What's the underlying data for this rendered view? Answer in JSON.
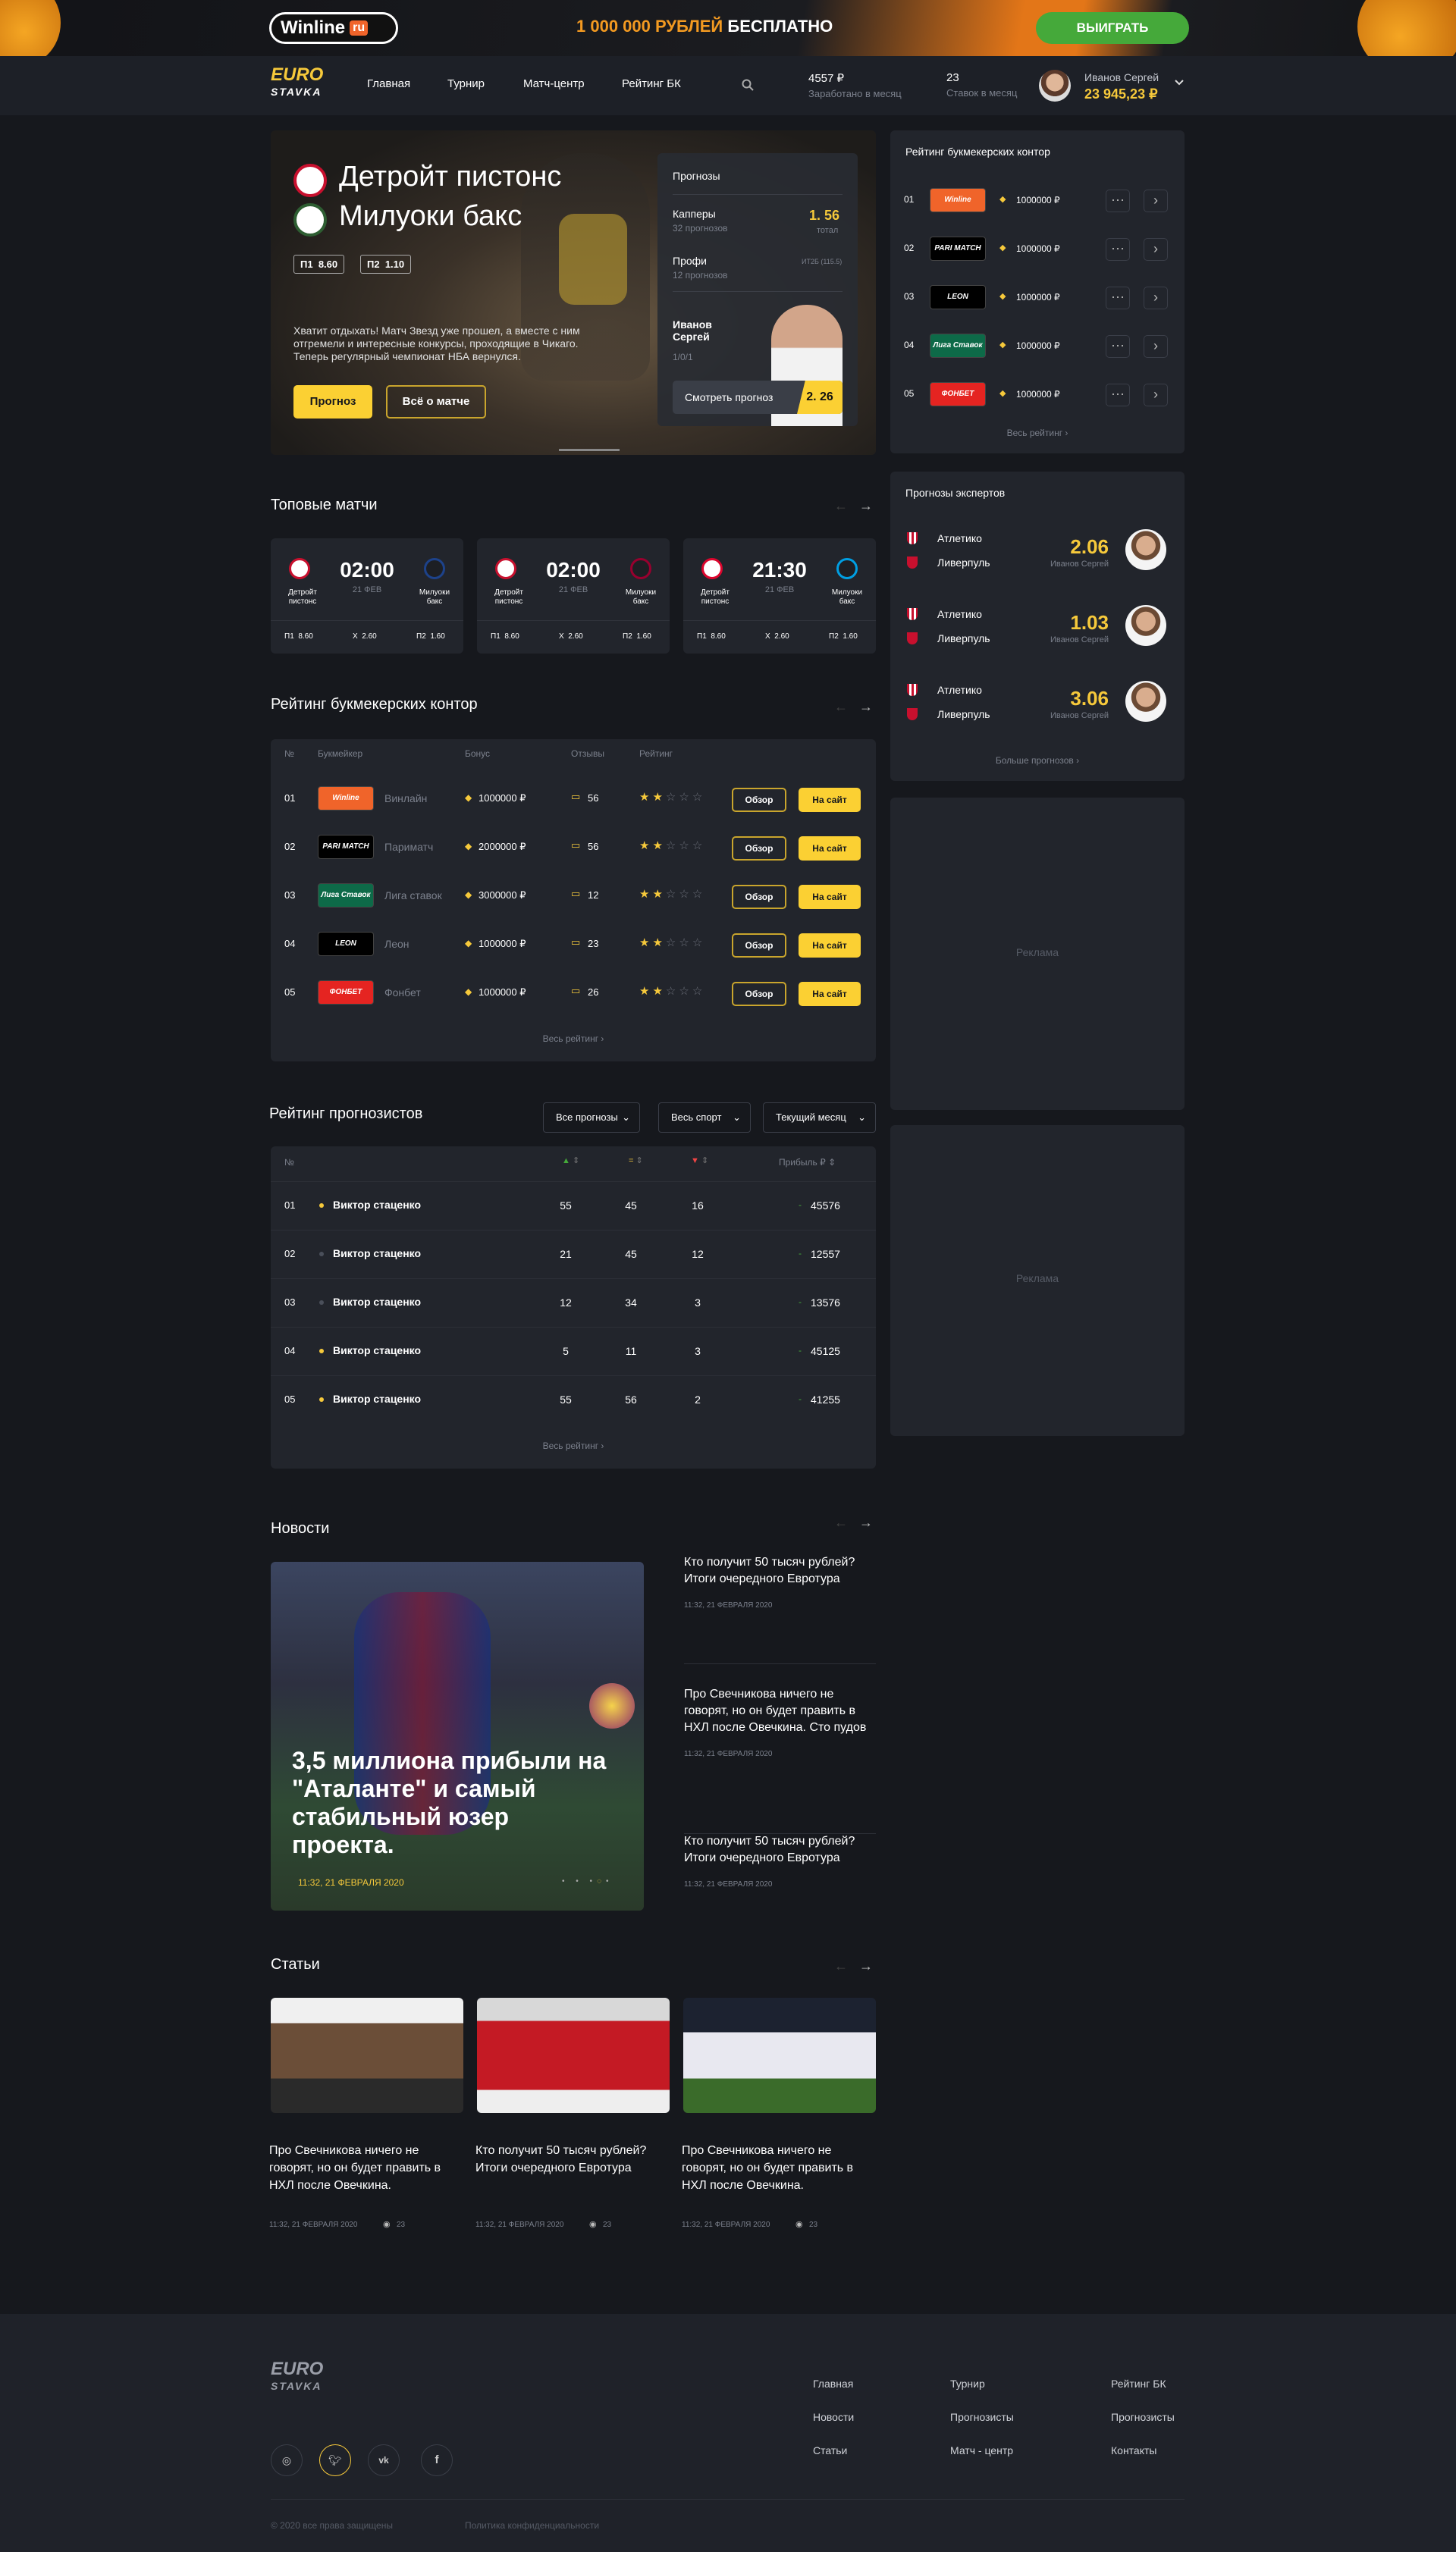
{
  "promo": {
    "logo": "Winline",
    "logo_suffix": "ru",
    "text_yellow": "1 000 000 РУБЛЕЙ",
    "text_white": "БЕСПЛАТНО",
    "button": "ВЫИГРАТЬ"
  },
  "nav": {
    "logo_top": "EURO",
    "logo_bottom": "STAVKA",
    "items": [
      "Главная",
      "Турнир",
      "Матч-центр",
      "Рейтинг БК"
    ],
    "stat1_value": "4557 ₽",
    "stat1_label": "Заработано в месяц",
    "stat2_value": "23",
    "stat2_label": "Ставок в месяц",
    "user_name": "Иванов Сергей",
    "user_balance": "23 945,23 ₽"
  },
  "hero": {
    "team1": "Детройт пистонс",
    "team2": "Милуоки бакс",
    "odd1_label": "П1",
    "odd1": "8.60",
    "odd2_label": "П2",
    "odd2": "1.10",
    "desc": "Хватит отдыхать! Матч Звезд уже прошел, а вместе с ним отгремели и интересные конкурсы, проходящие в Чикаго. Теперь регулярный чемпионат НБА вернулся.",
    "btn_forecast": "Прогноз",
    "btn_about": "Всё о матче",
    "card": {
      "title": "Прогнозы",
      "row1_title": "Капперы",
      "row1_sub": "32 прогнозов",
      "row1_val": "1. 56",
      "row1_val_sub": "тотал",
      "row2_title": "Профи",
      "row2_sub": "12 прогнозов",
      "row2_val": "ИТ2Б (115.5)",
      "expert_first": "Иванов",
      "expert_last": "Сергей",
      "expert_score": "1/0/1",
      "watch_btn": "Смотреть прогноз",
      "watch_val": "2. 26"
    }
  },
  "top_matches": {
    "title": "Топовые матчи",
    "matches": [
      {
        "time": "02:00",
        "date": "21 ФЕВ",
        "team1": "Детройт пистонс",
        "team2": "Милуоки бакс",
        "p1_label": "П1",
        "p1": "8.60",
        "x_label": "X",
        "x": "2.60",
        "p2_label": "П2",
        "p2": "1.60"
      },
      {
        "time": "02:00",
        "date": "21 ФЕВ",
        "team1": "Детройт пистонс",
        "team2": "Милуоки бакс",
        "p1_label": "П1",
        "p1": "8.60",
        "x_label": "X",
        "x": "2.60",
        "p2_label": "П2",
        "p2": "1.60"
      },
      {
        "time": "21:30",
        "date": "21 ФЕВ",
        "team1": "Детройт пистонс",
        "team2": "Милуоки бакс",
        "p1_label": "П1",
        "p1": "8.60",
        "x_label": "X",
        "x": "2.60",
        "p2_label": "П2",
        "p2": "1.60"
      }
    ]
  },
  "bk_rating": {
    "title": "Рейтинг букмекерских контор",
    "headers": [
      "№",
      "Букмейкер",
      "Бонус",
      "Отзывы",
      "Рейтинг"
    ],
    "rows": [
      {
        "num": "01",
        "logo": "Winline",
        "name": "Винлайн",
        "bonus": "1000000 ₽",
        "reviews": "56",
        "stars": 2,
        "logo_bg": "#f0642a"
      },
      {
        "num": "02",
        "logo": "PARI MATCH",
        "name": "Париматч",
        "bonus": "2000000 ₽",
        "reviews": "56",
        "stars": 2,
        "logo_bg": "#000000"
      },
      {
        "num": "03",
        "logo": "Лига Ставок",
        "name": "Лига ставок",
        "bonus": "3000000 ₽",
        "reviews": "12",
        "stars": 2,
        "logo_bg": "#0d6a48"
      },
      {
        "num": "04",
        "logo": "LEON",
        "name": "Леон",
        "bonus": "1000000 ₽",
        "reviews": "23",
        "stars": 2,
        "logo_bg": "#000000"
      },
      {
        "num": "05",
        "logo": "ФОНБЕТ",
        "name": "Фонбет",
        "bonus": "1000000 ₽",
        "reviews": "26",
        "stars": 2,
        "logo_bg": "#e52421"
      }
    ],
    "review_btn": "Обзор",
    "site_btn": "На сайт",
    "all_link": "Весь рейтинг"
  },
  "forecasters": {
    "title": "Рейтинг прогнозистов",
    "filters": [
      "Все прогнозы",
      "Весь спорт",
      "Текущий месяц"
    ],
    "headers": [
      "№",
      "",
      "",
      "",
      "Прибыль ₽"
    ],
    "rows": [
      {
        "num": "01",
        "name": "Виктор стаценко",
        "w": "55",
        "d": "45",
        "l": "16",
        "profit": "45576",
        "dot": "#f6c93b"
      },
      {
        "num": "02",
        "name": "Виктор стаценко",
        "w": "21",
        "d": "45",
        "l": "12",
        "profit": "12557",
        "dot": "#4a4f5a"
      },
      {
        "num": "03",
        "name": "Виктор стаценко",
        "w": "12",
        "d": "34",
        "l": "3",
        "profit": "13576",
        "dot": "#4a4f5a"
      },
      {
        "num": "04",
        "name": "Виктор стаценко",
        "w": "5",
        "d": "11",
        "l": "3",
        "profit": "45125",
        "dot": "#f6c93b"
      },
      {
        "num": "05",
        "name": "Виктор стаценко",
        "w": "55",
        "d": "56",
        "l": "2",
        "profit": "41255",
        "dot": "#f6c93b"
      }
    ],
    "all_link": "Весь рейтинг"
  },
  "news": {
    "title": "Новости",
    "main_title": "3,5 миллиона прибыли на \"Аталанте\" и самый стабильный юзер проекта.",
    "main_date": "11:32, 21 ФЕВРАЛЯ 2020",
    "items": [
      {
        "title": "Кто получит 50 тысяч рублей? Итоги очередного Евротура",
        "date": "11:32, 21 ФЕВРАЛЯ 2020"
      },
      {
        "title": "Про Свечникова ничего не говорят, но он будет править в НХЛ после Овечкина. Сто пудов",
        "date": "11:32, 21 ФЕВРАЛЯ 2020"
      },
      {
        "title": "Кто получит 50 тысяч рублей? Итоги очередного Евротура",
        "date": "11:32, 21 ФЕВРАЛЯ 2020"
      }
    ]
  },
  "articles": {
    "title": "Статьи",
    "items": [
      {
        "title": "Про Свечникова ничего не говорят, но он будет править в НХЛ после Овечкина.",
        "date": "11:32, 21 ФЕВРАЛЯ 2020",
        "views": "23"
      },
      {
        "title": "Кто получит 50 тысяч рублей? Итоги очередного Евротура",
        "date": "11:32, 21 ФЕВРАЛЯ 2020",
        "views": "23"
      },
      {
        "title": "Про Свечникова ничего не говорят, но он будет править в НХЛ после Овечкина.",
        "date": "11:32, 21 ФЕВРАЛЯ 2020",
        "views": "23"
      }
    ]
  },
  "sidebar": {
    "bk_title": "Рейтинг букмекерских контор",
    "bk_rows": [
      {
        "num": "01",
        "logo": "Winline",
        "bonus": "1000000 ₽",
        "logo_bg": "#f0642a"
      },
      {
        "num": "02",
        "logo": "PARI MATCH",
        "bonus": "1000000 ₽",
        "logo_bg": "#000000"
      },
      {
        "num": "03",
        "logo": "LEON",
        "bonus": "1000000 ₽",
        "logo_bg": "#000000"
      },
      {
        "num": "04",
        "logo": "Лига Ставок",
        "bonus": "1000000 ₽",
        "logo_bg": "#0d6a48"
      },
      {
        "num": "05",
        "logo": "ФОНБЕТ",
        "bonus": "1000000 ₽",
        "logo_bg": "#e52421"
      }
    ],
    "bk_all": "Весь рейтинг",
    "experts_title": "Прогнозы экспертов",
    "experts": [
      {
        "team1": "Атлетико",
        "team2": "Ливерпуль",
        "odd": "2.06",
        "name": "Иванов Сергей"
      },
      {
        "team1": "Атлетико",
        "team2": "Ливерпуль",
        "odd": "1.03",
        "name": "Иванов Сергей"
      },
      {
        "team1": "Атлетико",
        "team2": "Ливерпуль",
        "odd": "3.06",
        "name": "Иванов Сергей"
      }
    ],
    "experts_more": "Больше прогнозов",
    "ad1": "Реклама",
    "ad2": "Реклама"
  },
  "footer": {
    "logo_top": "EURO",
    "logo_bottom": "STAVKA",
    "links": [
      "Главная",
      "Турнир",
      "Рейтинг БК",
      "Новости",
      "Прогнозисты",
      "Прогнозисты",
      "Статьи",
      "Матч - центр",
      "Контакты"
    ],
    "copyright": "© 2020 все права защищены",
    "privacy": "Политика конфиденциальности"
  }
}
